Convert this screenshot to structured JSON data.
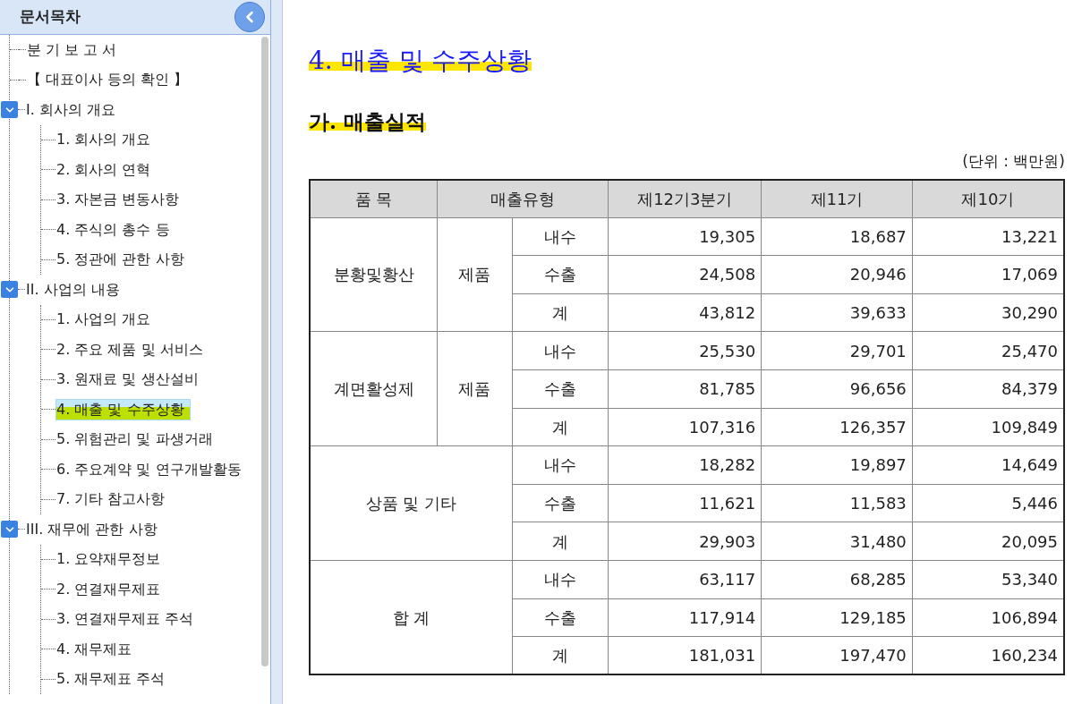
{
  "sidebar": {
    "title": "문서목차",
    "items": [
      {
        "label": "분 기 보 고 서",
        "selected": false
      },
      {
        "label": "【 대표이사 등의 확인 】",
        "selected": false
      },
      {
        "label": "I. 회사의 개요",
        "selected": false,
        "expanded": true,
        "children": [
          {
            "label": "1. 회사의 개요",
            "selected": false
          },
          {
            "label": "2. 회사의 연혁",
            "selected": false
          },
          {
            "label": "3. 자본금 변동사항",
            "selected": false
          },
          {
            "label": "4. 주식의 총수 등",
            "selected": false
          },
          {
            "label": "5. 정관에 관한 사항",
            "selected": false
          }
        ]
      },
      {
        "label": "II. 사업의 내용",
        "selected": false,
        "expanded": true,
        "children": [
          {
            "label": "1. 사업의 개요",
            "selected": false
          },
          {
            "label": "2. 주요 제품 및 서비스",
            "selected": false
          },
          {
            "label": "3. 원재료 및 생산설비",
            "selected": false
          },
          {
            "label": "4. 매출 및 수주상황",
            "selected": true
          },
          {
            "label": "5. 위험관리 및 파생거래",
            "selected": false
          },
          {
            "label": "6. 주요계약 및 연구개발활동",
            "selected": false
          },
          {
            "label": "7. 기타 참고사항",
            "selected": false
          }
        ]
      },
      {
        "label": "III. 재무에 관한 사항",
        "selected": false,
        "expanded": true,
        "children": [
          {
            "label": "1. 요약재무정보",
            "selected": false
          },
          {
            "label": "2. 연결재무제표",
            "selected": false
          },
          {
            "label": "3. 연결재무제표 주석",
            "selected": false
          },
          {
            "label": "4. 재무제표",
            "selected": false
          },
          {
            "label": "5. 재무제표 주석",
            "selected": false
          }
        ]
      }
    ]
  },
  "document": {
    "title": "4. 매출 및 수주상황",
    "subtitle": "가. 매출실적",
    "unit": "(단위 : 백만원)",
    "table": {
      "columns": [
        "품 목",
        "매출유형",
        "제12기3분기",
        "제11기",
        "제10기"
      ],
      "groups": [
        {
          "item": "분황및황산",
          "type": "제품",
          "rows": [
            {
              "sub": "내수",
              "values": [
                "19,305",
                "18,687",
                "13,221"
              ]
            },
            {
              "sub": "수출",
              "values": [
                "24,508",
                "20,946",
                "17,069"
              ]
            },
            {
              "sub": "계",
              "values": [
                "43,812",
                "39,633",
                "30,290"
              ]
            }
          ]
        },
        {
          "item": "계면활성제",
          "type": "제품",
          "rows": [
            {
              "sub": "내수",
              "values": [
                "25,530",
                "29,701",
                "25,470"
              ]
            },
            {
              "sub": "수출",
              "values": [
                "81,785",
                "96,656",
                "84,379"
              ]
            },
            {
              "sub": "계",
              "values": [
                "107,316",
                "126,357",
                "109,849"
              ]
            }
          ]
        },
        {
          "item": "상품 및 기타",
          "rows": [
            {
              "sub": "내수",
              "values": [
                "18,282",
                "19,897",
                "14,649"
              ]
            },
            {
              "sub": "수출",
              "values": [
                "11,621",
                "11,583",
                "5,446"
              ]
            },
            {
              "sub": "계",
              "values": [
                "29,903",
                "31,480",
                "20,095"
              ]
            }
          ]
        },
        {
          "item": "합 계",
          "rows": [
            {
              "sub": "내수",
              "values": [
                "63,117",
                "68,285",
                "53,340"
              ]
            },
            {
              "sub": "수출",
              "values": [
                "117,914",
                "129,185",
                "106,894"
              ]
            },
            {
              "sub": "계",
              "values": [
                "181,031",
                "197,470",
                "160,234"
              ]
            }
          ]
        }
      ]
    }
  }
}
